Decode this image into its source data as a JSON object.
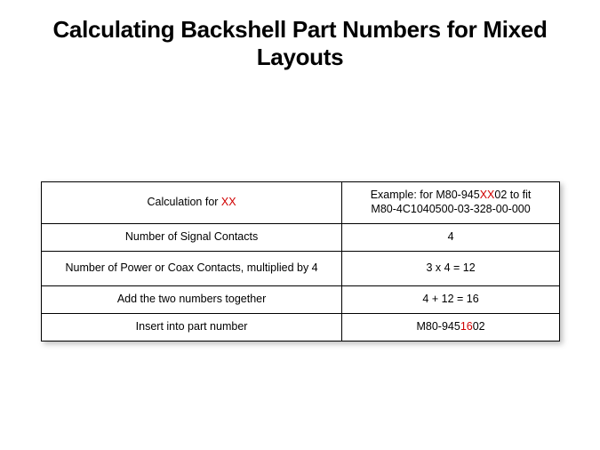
{
  "title": "Calculating Backshell Part Numbers for Mixed Layouts",
  "header": {
    "left_pre": "Calculation for ",
    "left_xx": "XX",
    "right_pre": "Example: for M80-945",
    "right_xx": "XX",
    "right_post": "02  to fit",
    "right_line2": "M80-4C1040500-03-328-00-000"
  },
  "rows": [
    {
      "left": "Number of Signal Contacts",
      "right": "4"
    },
    {
      "left": "Number of Power or Coax Contacts, multiplied by 4",
      "right": "3 x 4 = 12"
    },
    {
      "left": "Add the two numbers together",
      "right": "4 + 12 = 16"
    }
  ],
  "result": {
    "left": "Insert into part number",
    "right_pre": "M80-945",
    "right_mid": "16",
    "right_post": "02"
  }
}
